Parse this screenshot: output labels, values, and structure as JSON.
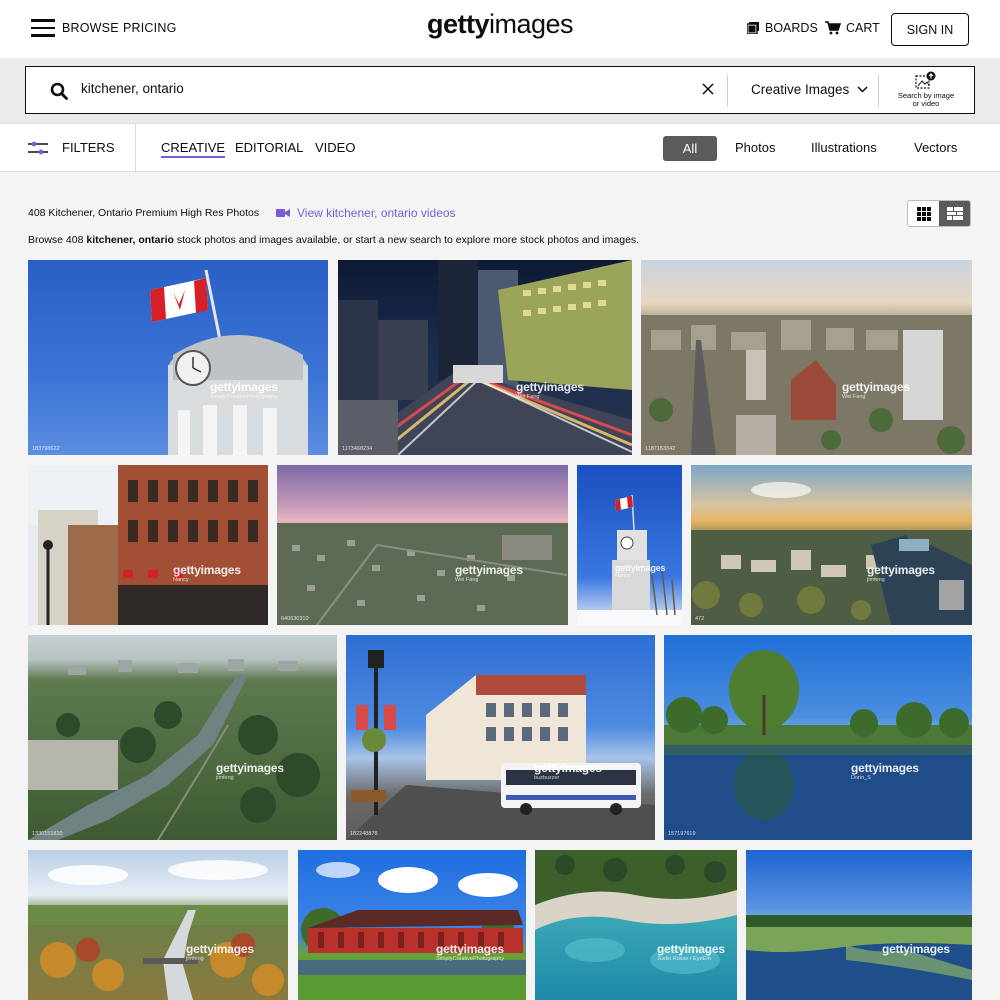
{
  "header": {
    "browse_label": "BROWSE",
    "pricing_label": "PRICING",
    "logo_bold": "getty",
    "logo_light": "images",
    "boards_label": "BOARDS",
    "cart_label": "CART",
    "signin_label": "SIGN IN"
  },
  "search": {
    "query": "kitchener, ontario",
    "category": "Creative Images",
    "search_by_image_line1": "Search by image",
    "search_by_image_line2": "or video"
  },
  "filterbar": {
    "filters_label": "FILTERS",
    "tabs": [
      "CREATIVE",
      "EDITORIAL",
      "VIDEO"
    ],
    "types": [
      "All",
      "Photos",
      "Illustrations",
      "Vectors"
    ]
  },
  "results": {
    "count_text": "408 Kitchener, Ontario Premium High Res Photos",
    "video_link": "View kitchener, ontario videos",
    "browse_prefix": "Browse 408 ",
    "browse_keyword": "kitchener, ontario",
    "browse_suffix": " stock photos and images available, or start a new search to explore more stock photos and images."
  },
  "watermark": "gettyimages",
  "images": [
    {
      "id": "183798622",
      "credit": "SimplyCreativePhotography"
    },
    {
      "id": "1173468234",
      "credit": "Wei Fang"
    },
    {
      "id": "1187153342",
      "credit": "Wei Fang"
    },
    {
      "id": "",
      "credit": "Nancy"
    },
    {
      "id": "640630310",
      "credit": "Wei Fang"
    },
    {
      "id": "",
      "credit": "Nancy"
    },
    {
      "id": "472",
      "credit": "jimfeng"
    },
    {
      "id": "1330151810",
      "credit": "jimfeng"
    },
    {
      "id": "182248878",
      "credit": "buzbuzzer"
    },
    {
      "id": "157197619",
      "credit": "Dorin_S"
    },
    {
      "id": "",
      "credit": "jimfeng"
    },
    {
      "id": "",
      "credit": "SimplyCreativePhotography"
    },
    {
      "id": "",
      "credit": "Justin Russo / EyeEm"
    },
    {
      "id": "",
      "credit": ""
    }
  ]
}
